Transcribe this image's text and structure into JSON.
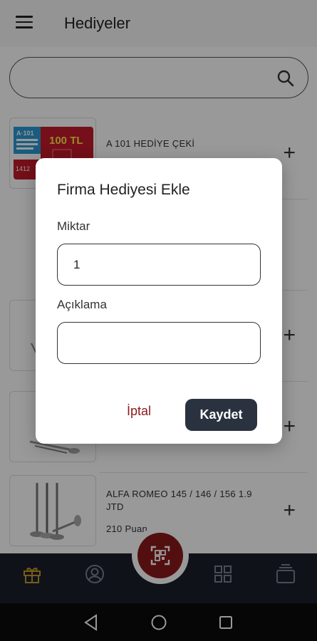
{
  "appbar": {
    "title": "Hediyeler",
    "menu_icon": "hamburger-menu-icon"
  },
  "search": {
    "value": "",
    "placeholder": "",
    "icon": "search-icon"
  },
  "items": [
    {
      "title": "A 101 HEDİYE ÇEKİ",
      "points": "",
      "thumb_text": "100 TL",
      "thumb_brand": "A·101",
      "thumb_code": "1412"
    },
    {
      "title": "",
      "points": ""
    },
    {
      "title": "",
      "points": ""
    },
    {
      "title": "",
      "points": ""
    },
    {
      "title": "ALFA ROMEO 145 / 146 / 156 1.9 JTD",
      "points": "210 Puan"
    }
  ],
  "bottom_nav": {
    "items": [
      "gift-icon",
      "profile-icon",
      "qr-scan-icon",
      "grid-icon",
      "layers-icon"
    ],
    "active": "gift-icon",
    "accent": "#c79a2a"
  },
  "dialog": {
    "title": "Firma Hediyesi Ekle",
    "quantity_label": "Miktar",
    "quantity_value": "1",
    "description_label": "Açıklama",
    "description_value": "",
    "cancel_label": "İptal",
    "save_label": "Kaydet"
  },
  "colors": {
    "primary_dark": "#2a3240",
    "accent_red": "#8a1a1a",
    "nav_bg": "#1a1f2a"
  }
}
